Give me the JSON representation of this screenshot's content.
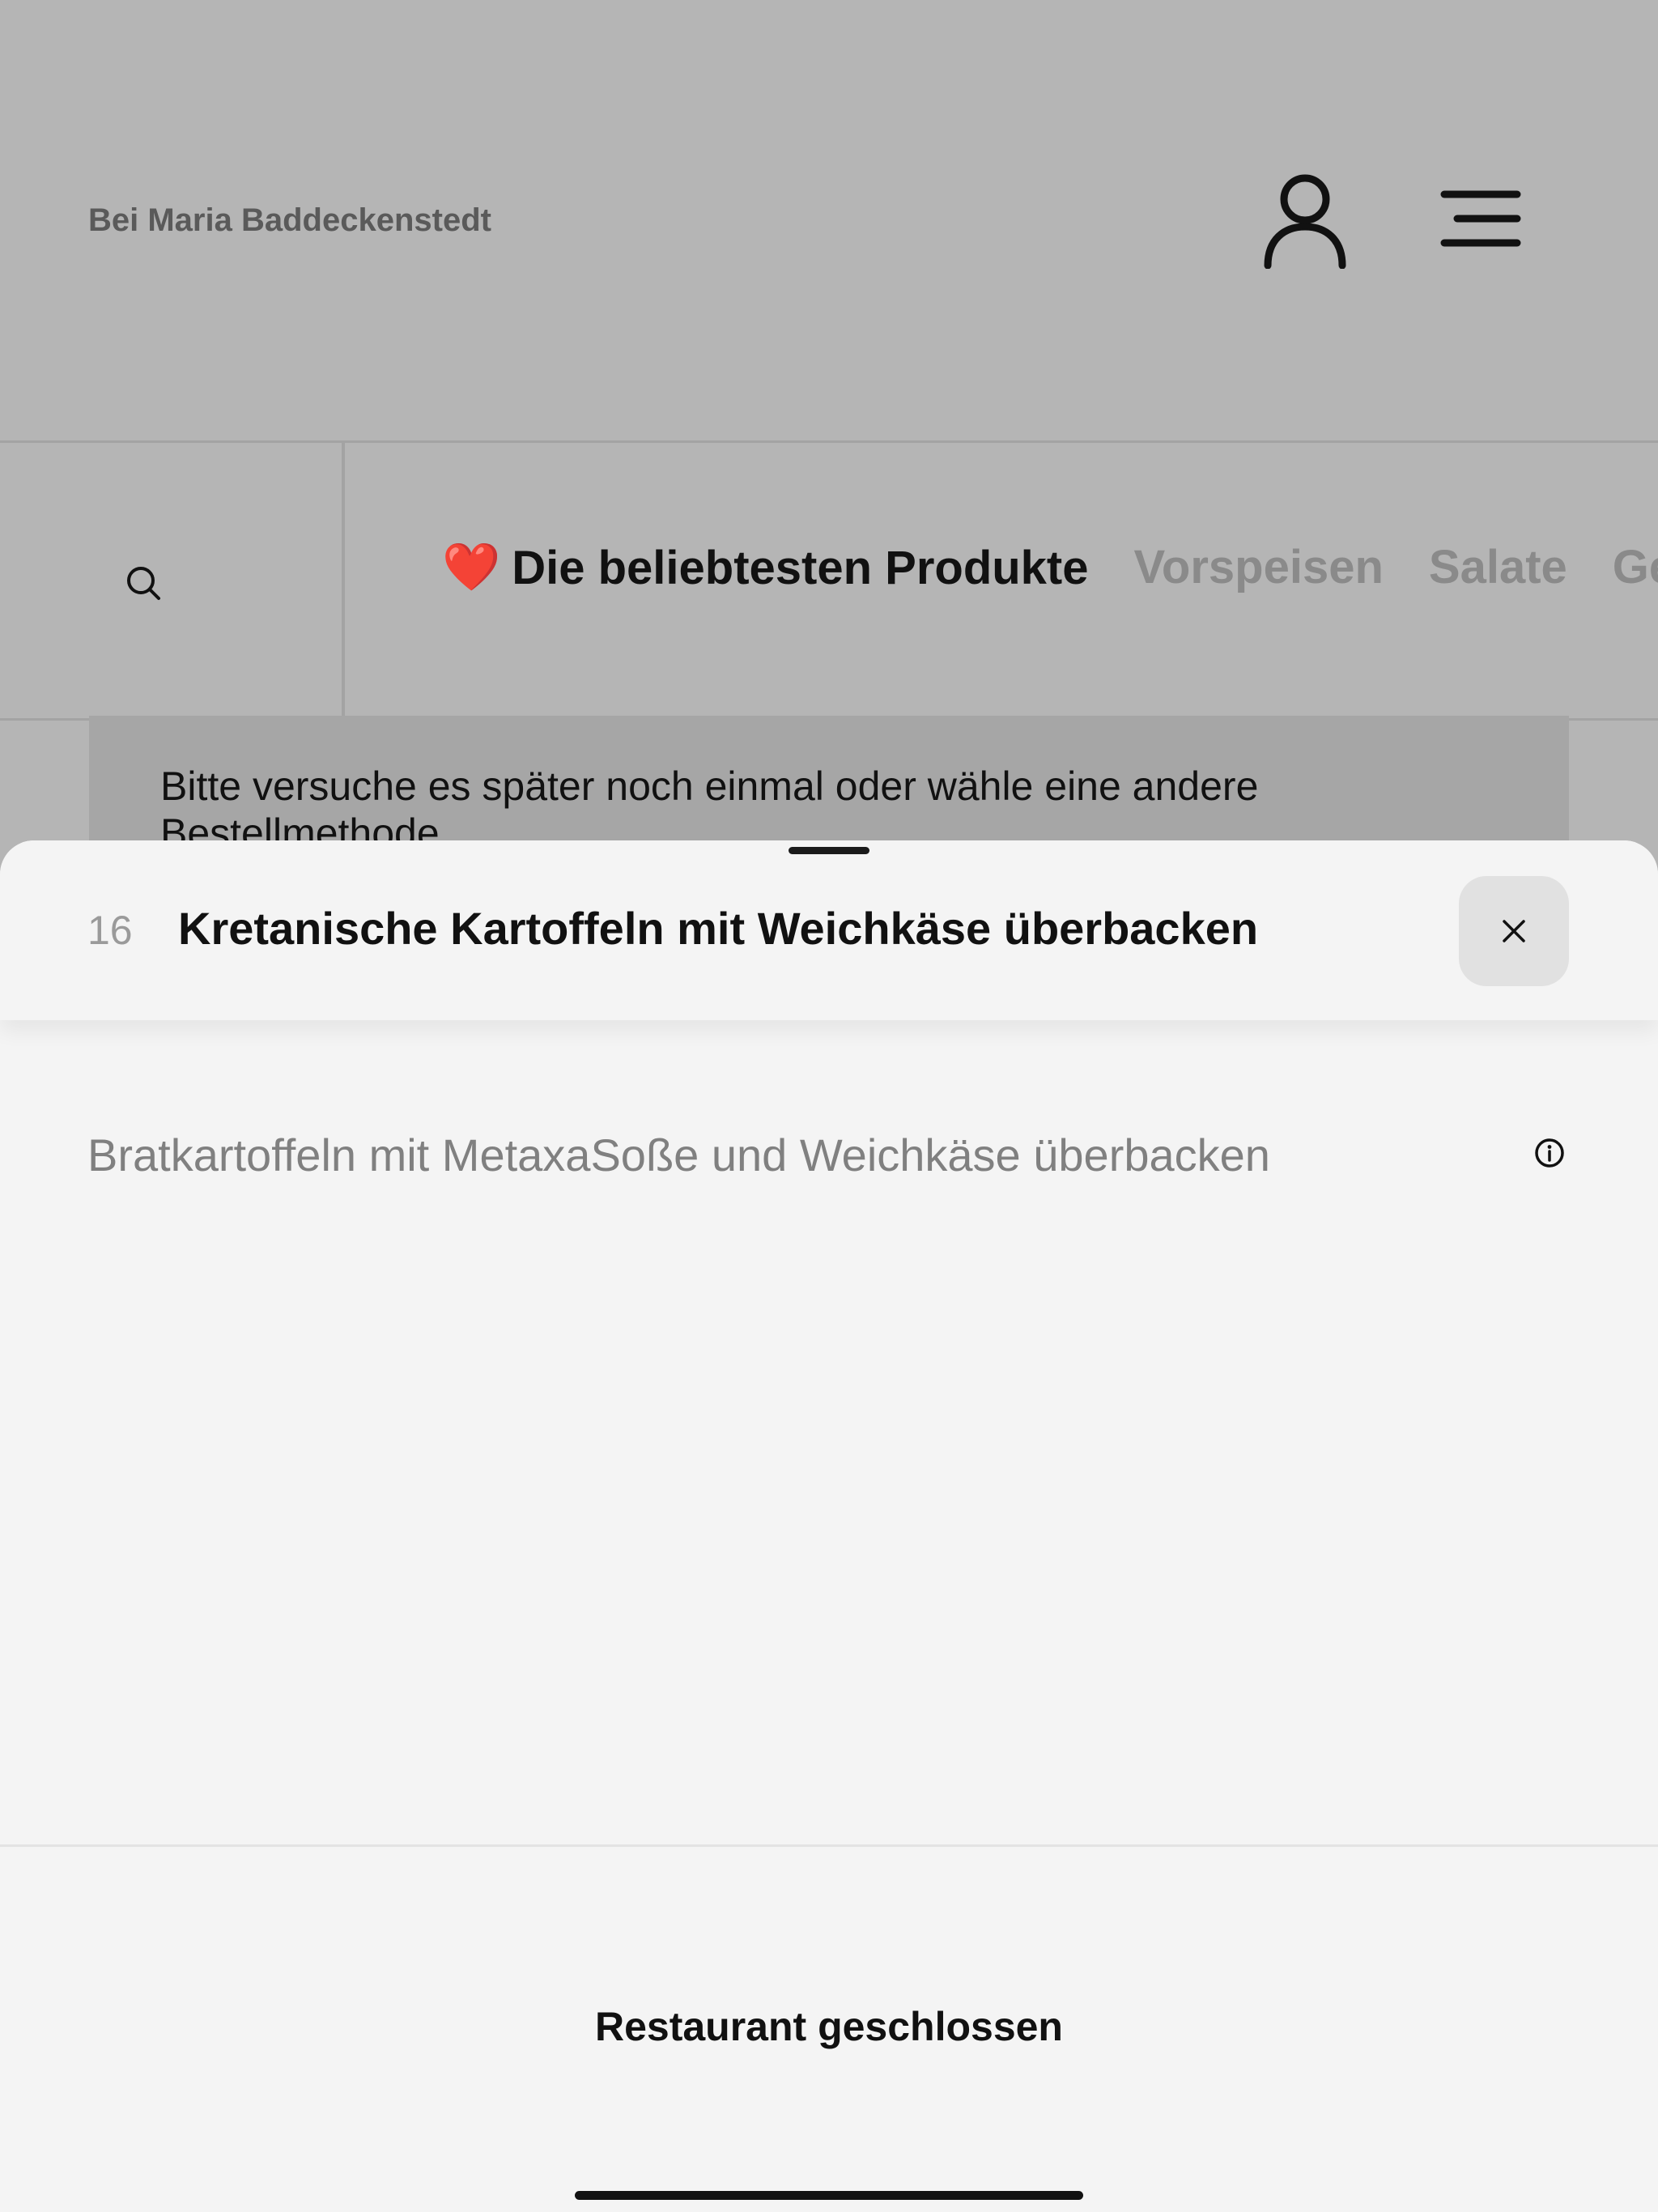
{
  "header": {
    "restaurant_name": "Bei Maria Baddeckenstedt",
    "icons": [
      "user-icon",
      "menu-icon"
    ]
  },
  "category_tabs": {
    "active": {
      "emoji": "❤️",
      "label": "Die beliebtesten Produkte"
    },
    "others": [
      "Vorspeisen",
      "Salate",
      "Ge"
    ]
  },
  "notice": {
    "text": "Bitte versuche es später noch einmal oder wähle eine andere Bestellmethode."
  },
  "product_sheet": {
    "number": "16",
    "title": "Kretanische Kartoffeln mit Weichkäse überbacken",
    "description": "Bratkartoffeln mit MetaxaSoße und Weichkäse überbacken",
    "status": "Restaurant geschlossen"
  },
  "colors": {
    "dim_background": "#b5b5b5",
    "sheet_background": "#f4f4f4",
    "heart": "#b3131c"
  }
}
